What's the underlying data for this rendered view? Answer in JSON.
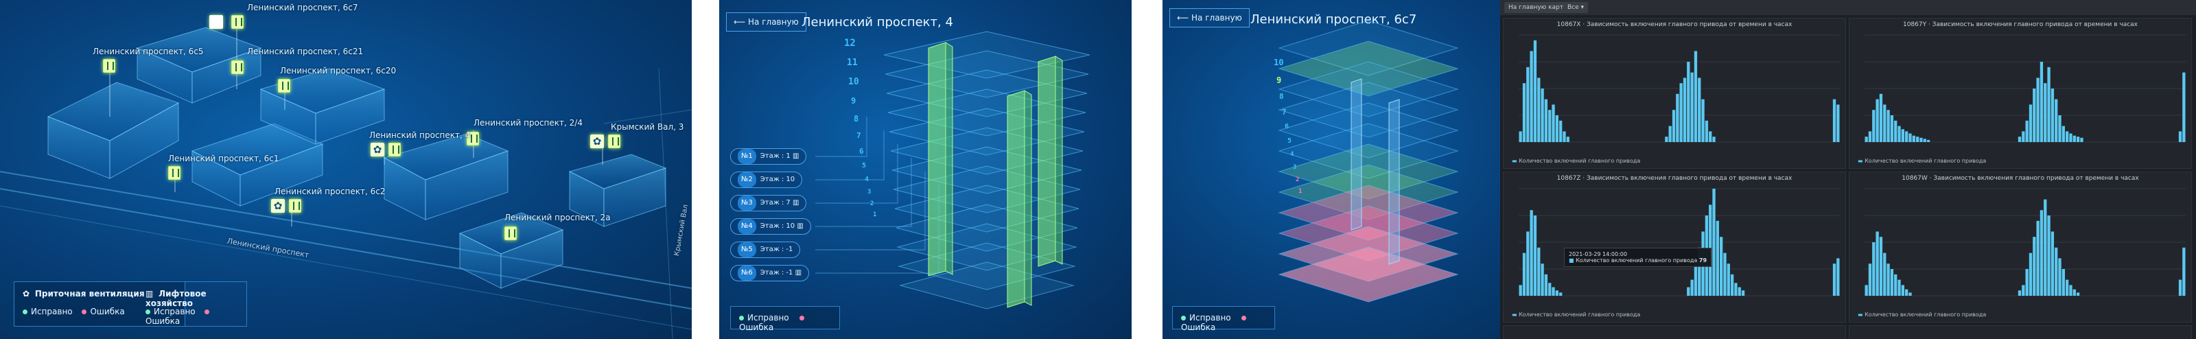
{
  "panel1": {
    "buildings": [
      {
        "label": "Ленинский проспект, 6с7",
        "icons": [
          "lift-icon"
        ]
      },
      {
        "label": "Ленинский проспект, 6с5",
        "icons": [
          "lift-icon"
        ]
      },
      {
        "label": "Ленинский проспект, 6с21",
        "icons": [
          "lift-icon"
        ]
      },
      {
        "label": "Ленинский проспект, 6с20",
        "icons": [
          "lift-icon"
        ]
      },
      {
        "label": "Ленинский проспект, 2/4",
        "icons": [
          "lift-icon"
        ]
      },
      {
        "label": "Крымский Вал, 3",
        "icons": [
          "fan-icon",
          "lift-icon"
        ]
      },
      {
        "label": "Ленинский проспект, 4",
        "icons": [
          "fan-icon",
          "lift-icon"
        ]
      },
      {
        "label": "Ленинский проспект, 6с1",
        "icons": [
          "lift-icon"
        ]
      },
      {
        "label": "Ленинский проспект, 6с2",
        "icons": [
          "fan-icon",
          "lift-icon"
        ]
      },
      {
        "label": "Ленинский проспект, 2а",
        "icons": [
          "lift-icon"
        ]
      }
    ],
    "street_label": "Ленинский проспект",
    "side_street_label": "Крымский Вал",
    "legend": {
      "ventilation": "Приточная вентиляция",
      "lifts": "Лифтовое хозяйство",
      "ok": "Исправно",
      "error": "Ошибка"
    }
  },
  "panel2": {
    "back_label": "На главную",
    "title": "Ленинский проспект, 4",
    "floors": [
      "12",
      "11",
      "10",
      "9",
      "8",
      "7",
      "6",
      "5",
      "4",
      "3",
      "2",
      "1"
    ],
    "lifts": [
      {
        "id": "№1",
        "floor_label": "Этаж : 1"
      },
      {
        "id": "№2",
        "floor_label": "Этаж : 10"
      },
      {
        "id": "№3",
        "floor_label": "Этаж : 7"
      },
      {
        "id": "№4",
        "floor_label": "Этаж : 10"
      },
      {
        "id": "№5",
        "floor_label": "Этаж : -1"
      },
      {
        "id": "№6",
        "floor_label": "Этаж : -1"
      }
    ],
    "legend": {
      "ok": "Исправно",
      "error": "Ошибка"
    }
  },
  "panel3": {
    "back_label": "На главную",
    "title": "Ленинский проспект, 6с7",
    "floors": [
      "10",
      "9",
      "8",
      "7",
      "6",
      "5",
      "4",
      "3",
      "2",
      "1"
    ],
    "legend": {
      "ok": "Исправно",
      "error": "Ошибка"
    }
  },
  "panel4": {
    "tabs": [
      "На главную карту",
      "Все"
    ],
    "colors": {
      "bar": "#5bc8f0",
      "background": "#1c1f24"
    },
    "tooltip": {
      "date": "2021-03-29 14:00:00",
      "series": "Количество включений главного привода",
      "value": "79"
    },
    "legend_label": "Количество включений главного привода",
    "panels": [
      {
        "title": "10867X · Зависимость включения главного привода от времени в часах"
      },
      {
        "title": "10867Y · Зависимость включения главного привода от времени в часах"
      },
      {
        "title": "10867Z · Зависимость включения главного привода от времени в часах"
      },
      {
        "title": "10867W · Зависимость включения главного привода от времени в часах"
      }
    ]
  },
  "chart_data": [
    {
      "type": "bar",
      "title": "",
      "series": [
        {
          "name": "Количество включений главного привода",
          "values": [
            10,
            55,
            70,
            85,
            95,
            60,
            50,
            40,
            30,
            35,
            25,
            20,
            10,
            5,
            0,
            0,
            0,
            0,
            0,
            0,
            0,
            0,
            0,
            0,
            0,
            0,
            0,
            0,
            0,
            0,
            0,
            0,
            0,
            0,
            0,
            0,
            0,
            0,
            0,
            0,
            5,
            15,
            30,
            45,
            55,
            60,
            75,
            65,
            85,
            60,
            40,
            20,
            10,
            5,
            0,
            0,
            0,
            0,
            0,
            0,
            0,
            0,
            0,
            0,
            0,
            0,
            0,
            0,
            0,
            0,
            0,
            0,
            0,
            0,
            0,
            0,
            0,
            0,
            0,
            0,
            0,
            0,
            0,
            0,
            0,
            0,
            40,
            35
          ]
        }
      ]
    },
    {
      "type": "bar",
      "title": "",
      "series": [
        {
          "name": "Количество включений главного привода",
          "values": [
            5,
            10,
            30,
            40,
            45,
            35,
            30,
            25,
            20,
            15,
            12,
            10,
            8,
            6,
            5,
            4,
            3,
            2,
            0,
            0,
            0,
            0,
            0,
            0,
            0,
            0,
            0,
            0,
            0,
            0,
            0,
            0,
            0,
            0,
            0,
            0,
            0,
            0,
            0,
            0,
            0,
            0,
            5,
            10,
            20,
            35,
            50,
            60,
            75,
            55,
            70,
            50,
            40,
            25,
            15,
            10,
            8,
            6,
            5,
            4,
            0,
            0,
            0,
            0,
            0,
            0,
            0,
            0,
            0,
            0,
            0,
            0,
            0,
            0,
            0,
            0,
            0,
            0,
            0,
            0,
            0,
            0,
            0,
            0,
            0,
            0,
            10,
            65
          ]
        }
      ]
    },
    {
      "type": "bar",
      "title": "",
      "series": [
        {
          "name": "Количество включений главного привода",
          "values": [
            10,
            40,
            60,
            80,
            75,
            45,
            30,
            20,
            12,
            8,
            5,
            3,
            0,
            0,
            0,
            0,
            0,
            0,
            0,
            0,
            0,
            0,
            0,
            0,
            0,
            0,
            0,
            0,
            0,
            0,
            0,
            0,
            0,
            0,
            0,
            0,
            0,
            0,
            0,
            0,
            0,
            0,
            0,
            0,
            0,
            0,
            8,
            15,
            30,
            45,
            60,
            75,
            85,
            100,
            70,
            55,
            40,
            30,
            20,
            12,
            8,
            5,
            0,
            0,
            0,
            0,
            0,
            0,
            0,
            0,
            0,
            0,
            0,
            0,
            0,
            0,
            0,
            0,
            0,
            0,
            0,
            0,
            0,
            0,
            0,
            0,
            30,
            35
          ]
        }
      ]
    },
    {
      "type": "bar",
      "title": "",
      "series": [
        {
          "name": "Количество включений главного привода",
          "values": [
            10,
            30,
            50,
            60,
            55,
            40,
            30,
            25,
            20,
            15,
            10,
            6,
            3,
            0,
            0,
            0,
            0,
            0,
            0,
            0,
            0,
            0,
            0,
            0,
            0,
            0,
            0,
            0,
            0,
            0,
            0,
            0,
            0,
            0,
            0,
            0,
            0,
            0,
            0,
            0,
            0,
            0,
            5,
            10,
            25,
            40,
            55,
            70,
            80,
            90,
            75,
            60,
            45,
            35,
            25,
            15,
            10,
            6,
            3,
            0,
            0,
            0,
            0,
            0,
            0,
            0,
            0,
            0,
            0,
            0,
            0,
            0,
            0,
            0,
            0,
            0,
            0,
            0,
            0,
            0,
            0,
            0,
            0,
            0,
            0,
            0,
            15,
            45
          ]
        }
      ]
    }
  ]
}
